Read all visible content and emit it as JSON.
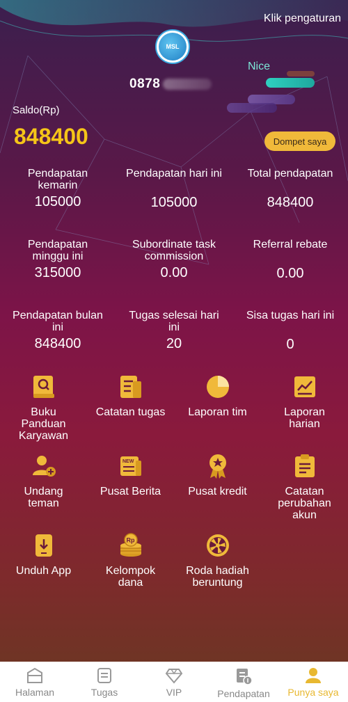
{
  "header": {
    "settings_link": "Klik pengaturan",
    "logo_text": "MSL",
    "phone_visible": "0878",
    "nice_label": "Nice"
  },
  "balance": {
    "label": "Saldo(Rp)",
    "value": "848400",
    "wallet_button": "Dompet saya"
  },
  "stats": [
    {
      "label": "Pendapatan kemarin",
      "value": "105000"
    },
    {
      "label": "Pendapatan hari ini",
      "value": "105000"
    },
    {
      "label": "Total pendapatan",
      "value": "848400"
    },
    {
      "label": "Pendapatan minggu ini",
      "value": "315000"
    },
    {
      "label": "Subordinate task commission",
      "value": "0.00"
    },
    {
      "label": "Referral rebate",
      "value": "0.00"
    },
    {
      "label": "Pendapatan bulan ini",
      "value": "848400"
    },
    {
      "label": "Tugas selesai hari ini",
      "value": "20"
    },
    {
      "label": "Sisa tugas hari ini",
      "value": "0"
    }
  ],
  "menu": [
    {
      "label": "Buku Panduan Karyawan",
      "icon": "handbook-icon"
    },
    {
      "label": "Catatan tugas",
      "icon": "task-record-icon"
    },
    {
      "label": "Laporan tim",
      "icon": "pie-chart-icon"
    },
    {
      "label": "Laporan harian",
      "icon": "line-chart-icon"
    },
    {
      "label": "Undang teman",
      "icon": "invite-friend-icon"
    },
    {
      "label": "Pusat Berita",
      "icon": "news-icon"
    },
    {
      "label": "Pusat kredit",
      "icon": "medal-icon"
    },
    {
      "label": "Catatan perubahan akun",
      "icon": "clipboard-icon"
    },
    {
      "label": "Unduh App",
      "icon": "download-app-icon"
    },
    {
      "label": "Kelompok dana",
      "icon": "coin-stack-icon"
    },
    {
      "label": "Roda hadiah beruntung",
      "icon": "wheel-icon"
    }
  ],
  "tabbar": {
    "tabs": [
      {
        "label": "Halaman",
        "icon": "home-icon"
      },
      {
        "label": "Tugas",
        "icon": "task-icon"
      },
      {
        "label": "VIP",
        "icon": "diamond-icon"
      },
      {
        "label": "Pendapatan",
        "icon": "income-icon"
      },
      {
        "label": "Punya saya",
        "icon": "profile-icon"
      }
    ],
    "active_tab": "Punya saya"
  },
  "colors": {
    "accent": "#f5c518",
    "icon_gold": "#f0b93a",
    "tab_active": "#e8b830"
  }
}
